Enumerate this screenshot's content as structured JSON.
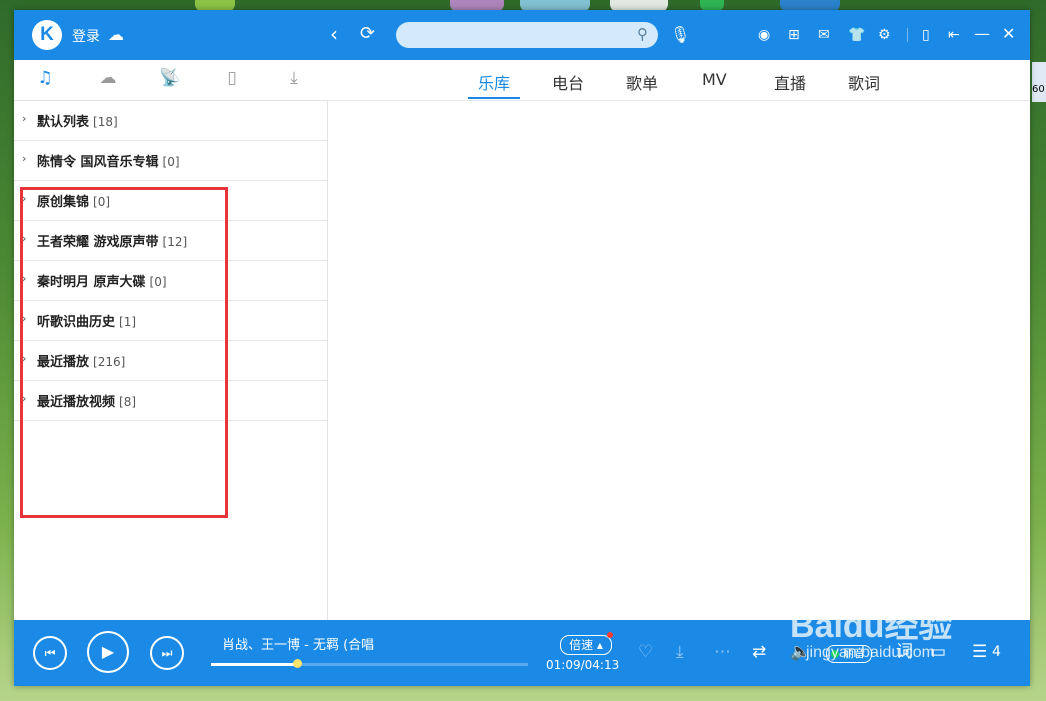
{
  "colors": {
    "accent": "#1a8ae6",
    "highlight_box": "#e8353a"
  },
  "titlebar": {
    "logo_letter": "K",
    "login_label": "登录",
    "search": {
      "placeholder": "",
      "value": ""
    },
    "icons": [
      "cloud-icon",
      "back-icon",
      "refresh-icon",
      "search-icon",
      "mic-icon",
      "target-icon",
      "grid-icon",
      "mail-icon",
      "skin-icon",
      "settings-icon",
      "phone-icon",
      "collapse-icon",
      "minimize-icon",
      "close-icon"
    ]
  },
  "left_tabs": [
    "music-note-icon",
    "cloud-icon",
    "broadcast-icon",
    "device-icon",
    "download-icon"
  ],
  "playlists": [
    {
      "name": "默认列表",
      "count": "[18]"
    },
    {
      "name": "陈情令 国风音乐专辑",
      "count": "[0]"
    },
    {
      "name": "原创集锦",
      "count": "[0]"
    },
    {
      "name": "王者荣耀 游戏原声带",
      "count": "[12]"
    },
    {
      "name": "秦时明月 原声大碟",
      "count": "[0]"
    },
    {
      "name": "听歌识曲历史",
      "count": "[1]"
    },
    {
      "name": "最近播放",
      "count": "[216]"
    },
    {
      "name": "最近播放视频",
      "count": "[8]"
    }
  ],
  "main_tabs": [
    "乐库",
    "电台",
    "歌单",
    "MV",
    "直播",
    "歌词"
  ],
  "active_main_tab": "乐库",
  "player": {
    "song": "肖战、王一博 - 无羁 (合唱",
    "speed_label": "倍速",
    "time": "01:09/04:13",
    "progress": 0.27,
    "quality_label": "丽音",
    "lyric_label": "词",
    "playlist_count": "4"
  },
  "watermark": {
    "brand": "Baidu经验",
    "url": "jingyan.baidu.com"
  },
  "desktop": {
    "corner_label": "60"
  }
}
